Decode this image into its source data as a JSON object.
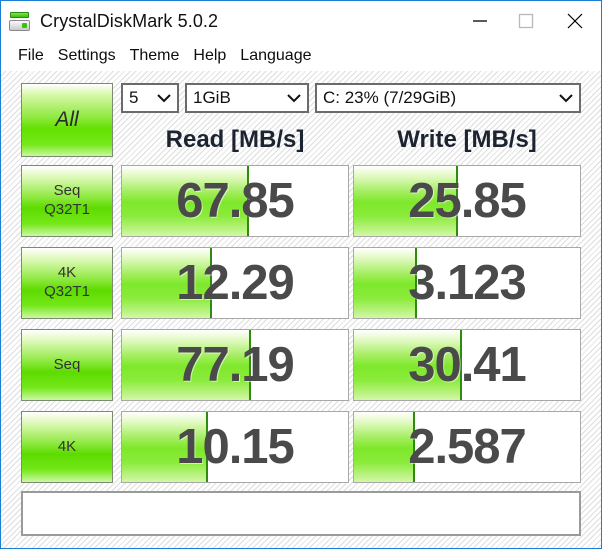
{
  "window": {
    "title": "CrystalDiskMark 5.0.2",
    "icon": "disk-drive-icon",
    "minimize_label": "—",
    "maximize_label": "□",
    "close_label": "✕"
  },
  "menu": {
    "items": [
      {
        "label": "File"
      },
      {
        "label": "Settings"
      },
      {
        "label": "Theme"
      },
      {
        "label": "Help"
      },
      {
        "label": "Language"
      }
    ]
  },
  "toolbar": {
    "all_button_label": "All",
    "run_count": "5",
    "test_size": "1GiB",
    "target_drive": "C: 23% (7/29GiB)"
  },
  "columns": {
    "read_header": "Read [MB/s]",
    "write_header": "Write [MB/s]"
  },
  "status": {
    "text": ""
  },
  "colors": {
    "accent_green": "#63e000",
    "bar_green": "#7ee82b",
    "bar_divider": "#2f8a10",
    "window_border": "#1a7fd4",
    "score_text": "#4a4a4a",
    "header_text": "#1b2430"
  },
  "chart_data": {
    "type": "bar",
    "title": "CrystalDiskMark 5.0.2 benchmark results",
    "unit": "MB/s",
    "test_size": "1GiB",
    "run_count": 5,
    "target": "C: 23% (7/29GiB)",
    "categories": [
      "Seq Q32T1",
      "4K Q32T1",
      "Seq",
      "4K"
    ],
    "series": [
      {
        "name": "Read [MB/s]",
        "values": [
          67.85,
          12.29,
          77.19,
          10.15
        ]
      },
      {
        "name": "Write [MB/s]",
        "values": [
          25.85,
          3.123,
          30.41,
          2.587
        ]
      }
    ]
  },
  "rows": [
    {
      "label": "Seq",
      "sub": "Q32T1",
      "read": {
        "value": "67.85",
        "fill_pct": 56
      },
      "write": {
        "value": "25.85",
        "fill_pct": 46
      }
    },
    {
      "label": "4K",
      "sub": "Q32T1",
      "read": {
        "value": "12.29",
        "fill_pct": 40
      },
      "write": {
        "value": "3.123",
        "fill_pct": 28
      }
    },
    {
      "label": "Seq",
      "sub": "",
      "read": {
        "value": "77.19",
        "fill_pct": 57
      },
      "write": {
        "value": "30.41",
        "fill_pct": 48
      }
    },
    {
      "label": "4K",
      "sub": "",
      "read": {
        "value": "10.15",
        "fill_pct": 38
      },
      "write": {
        "value": "2.587",
        "fill_pct": 27
      }
    }
  ]
}
